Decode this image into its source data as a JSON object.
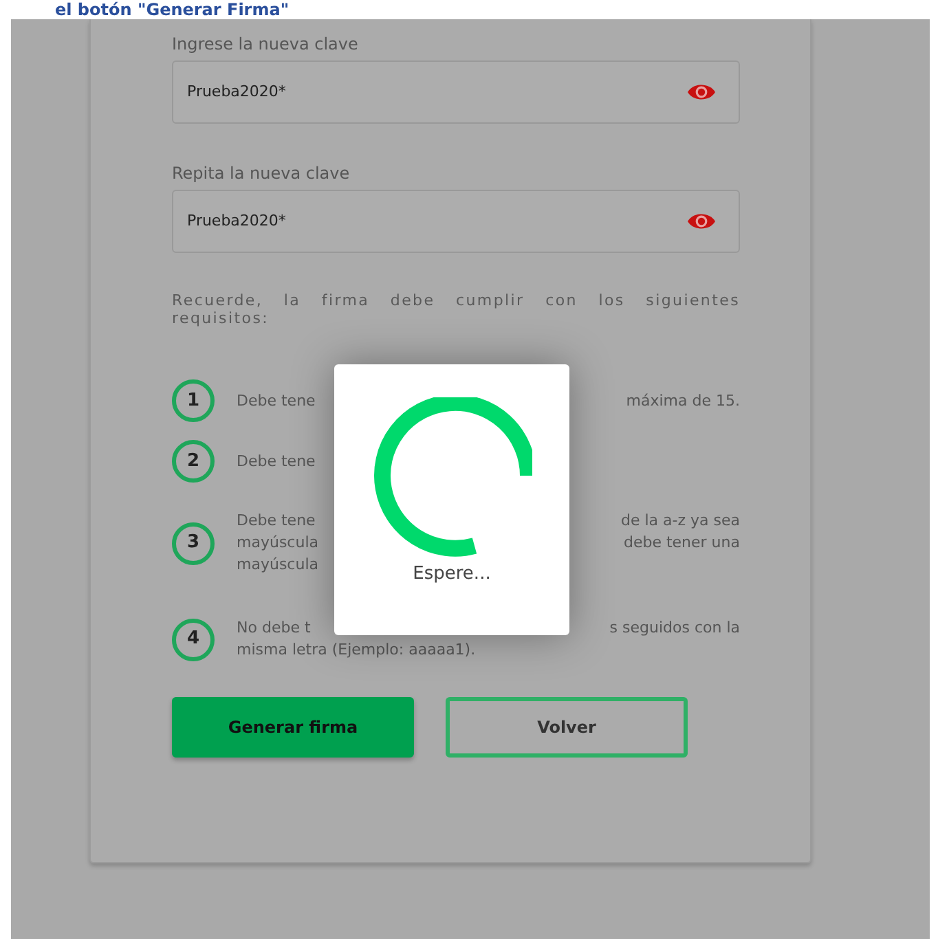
{
  "heading": "el botón \"Generar Firma\"",
  "fields": [
    {
      "label": "Ingrese la nueva clave",
      "value": "Prueba2020*"
    },
    {
      "label": "Repita la nueva clave",
      "value": "Prueba2020*"
    }
  ],
  "requirements_intro": "Recuerde, la firma debe cumplir con los siguientes requisitos:",
  "requirements": [
    {
      "number": "1",
      "lines": [
        {
          "left": "Debe tene",
          "right": "máxima de 15."
        }
      ]
    },
    {
      "number": "2",
      "lines": [
        {
          "left": "Debe tene"
        }
      ]
    },
    {
      "number": "3",
      "lines": [
        {
          "left": "Debe tene",
          "right": "de la a-z ya sea"
        },
        {
          "left": "mayúscula",
          "right": "debe tener una"
        },
        {
          "left": "mayúscula"
        }
      ]
    },
    {
      "number": "4",
      "lines": [
        {
          "left": "No debe t",
          "right": "s seguidos con la"
        },
        {
          "left": "misma letra (Ejemplo: aaaaa1)."
        }
      ]
    }
  ],
  "buttons": [
    {
      "label": "Generar firma",
      "kind": "primary"
    },
    {
      "label": "Volver",
      "kind": "outline"
    }
  ],
  "loading_dialog": {
    "message": "Espere..."
  }
}
